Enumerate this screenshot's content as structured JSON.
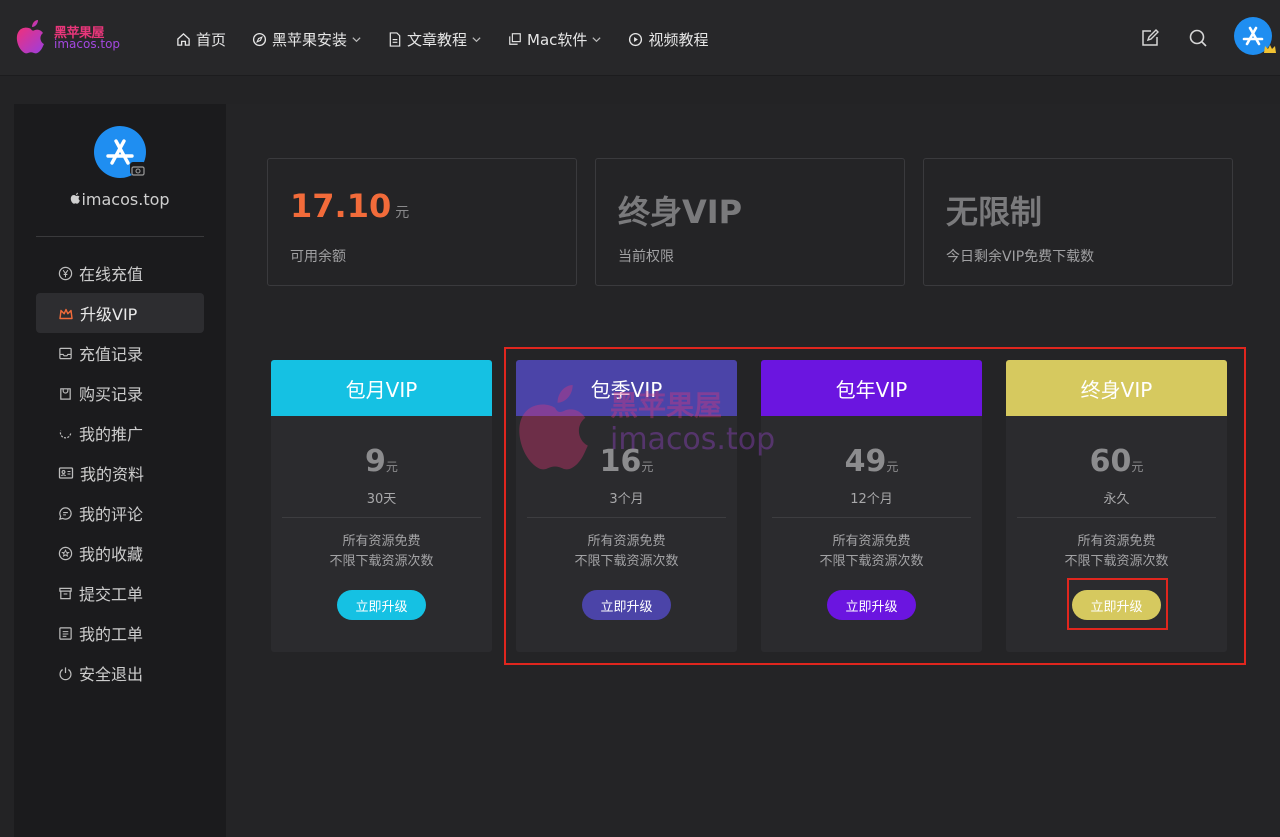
{
  "logo": {
    "line1": "黑苹果屋",
    "line2": "imacos.top"
  },
  "nav": [
    {
      "label": "首页",
      "icon": "home-icon",
      "dropdown": false
    },
    {
      "label": "黑苹果安装",
      "icon": "compass-icon",
      "dropdown": true
    },
    {
      "label": "文章教程",
      "icon": "document-icon",
      "dropdown": true
    },
    {
      "label": "Mac软件",
      "icon": "copy-icon",
      "dropdown": true
    },
    {
      "label": "视频教程",
      "icon": "play-icon",
      "dropdown": false
    }
  ],
  "header_icons": [
    "edit-icon",
    "search-icon",
    "app-store-avatar",
    "crown-icon"
  ],
  "sidebar": {
    "username": "imacos.top",
    "items": [
      {
        "label": "在线充值",
        "icon": "yen-icon"
      },
      {
        "label": "升级VIP",
        "icon": "crown-icon",
        "active": true
      },
      {
        "label": "充值记录",
        "icon": "inbox-icon"
      },
      {
        "label": "购买记录",
        "icon": "bag-icon"
      },
      {
        "label": "我的推广",
        "icon": "refresh-icon"
      },
      {
        "label": "我的资料",
        "icon": "id-card-icon"
      },
      {
        "label": "我的评论",
        "icon": "comment-icon"
      },
      {
        "label": "我的收藏",
        "icon": "star-icon"
      },
      {
        "label": "提交工单",
        "icon": "ticket-icon"
      },
      {
        "label": "我的工单",
        "icon": "list-icon"
      },
      {
        "label": "安全退出",
        "icon": "power-icon"
      }
    ]
  },
  "stats": [
    {
      "value": "17.10",
      "unit": "元",
      "label": "可用余额"
    },
    {
      "value": "终身VIP",
      "unit": "",
      "label": "当前权限"
    },
    {
      "value": "无限制",
      "unit": "",
      "label": "今日剩余VIP免费下载数"
    }
  ],
  "plans": [
    {
      "name": "包月VIP",
      "price": "9",
      "unit": "元",
      "duration": "30天",
      "feature1": "所有资源免费",
      "feature2": "不限下载资源次数",
      "button": "立即升级",
      "color": "#15c1e3"
    },
    {
      "name": "包季VIP",
      "price": "16",
      "unit": "元",
      "duration": "3个月",
      "feature1": "所有资源免费",
      "feature2": "不限下载资源次数",
      "button": "立即升级",
      "color": "#4b44a8"
    },
    {
      "name": "包年VIP",
      "price": "49",
      "unit": "元",
      "duration": "12个月",
      "feature1": "所有资源免费",
      "feature2": "不限下载资源次数",
      "button": "立即升级",
      "color": "#6b15e0"
    },
    {
      "name": "终身VIP",
      "price": "60",
      "unit": "元",
      "duration": "永久",
      "feature1": "所有资源免费",
      "feature2": "不限下载资源次数",
      "button": "立即升级",
      "color": "#d6c95f"
    }
  ],
  "watermark": {
    "line1": "黑苹果屋",
    "line2": "imacos.top"
  },
  "colors": {
    "accent_orange": "#f26b3a",
    "highlight_red": "#e0261e"
  }
}
